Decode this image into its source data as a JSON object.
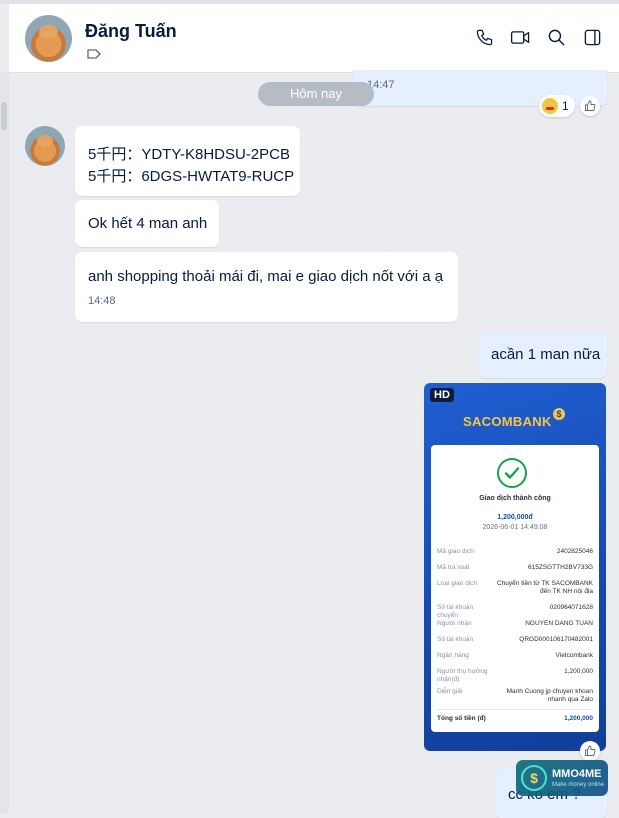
{
  "header": {
    "contact_name": "Đăng Tuấn",
    "icons": [
      "phone-icon",
      "video-call-icon",
      "search-icon",
      "sidebar-toggle-icon"
    ]
  },
  "conversation": {
    "previous_message_time": "14:47",
    "date_separator": "Hôm nay",
    "reaction": {
      "emoji": "laughing-emoji",
      "count": "1"
    },
    "messages": [
      {
        "sender": "contact",
        "lines": [
          "5千円：YDTY-K8HDSU-2PCB",
          "5千円：6DGS-HWTAT9-RUCP"
        ]
      },
      {
        "sender": "contact",
        "text": "Ok hết 4 man anh"
      },
      {
        "sender": "contact",
        "text": "anh shopping thoải mái đi, mai e giao dịch nốt với a ạ",
        "time": "14:48"
      },
      {
        "sender": "me",
        "text": "acần 1 man nữa"
      },
      {
        "sender": "me",
        "text": "cc ko em ?"
      }
    ],
    "image_message": {
      "badge": "HD",
      "bank_name": "SACOMBANK",
      "bank_logo_symbol": "$",
      "status": "Giao dịch thành công",
      "amount": "1,200,000đ",
      "datetime": "2026-06-01 14:49:08",
      "rows": [
        {
          "label": "Mã giao dịch",
          "value": "2402825046"
        },
        {
          "label": "Mã tra soát",
          "value": "615ZSGTTH2BV733G"
        },
        {
          "label": "Loại giao dịch",
          "value": "Chuyển tiền từ TK SACOMBANK đến TK NH nội địa"
        },
        {
          "label": "Số tài khoản chuyển",
          "value": "020964071628"
        },
        {
          "label": "Người nhận",
          "value": "NGUYEN DANG TUAN"
        },
        {
          "label": "Số tài khoản",
          "value": "QRGD0001061704820​01"
        },
        {
          "label": "Ngân hàng",
          "value": "Vietcombank"
        },
        {
          "label": "Người thụ hưởng nhận(đ)",
          "value": "1,200,000"
        },
        {
          "label": "Diễn giải",
          "value": "Manh Cuong jp chuyen khoan nhanh qua Zalo"
        }
      ],
      "total": {
        "label": "Tổng số tiền (đ)",
        "value": "1,200,000"
      }
    }
  },
  "watermark": {
    "title": "MMO4ME",
    "subtitle": "Make money online"
  },
  "colors": {
    "app_bg": "#ebecf0",
    "my_bubble": "#e5efff",
    "contact_bubble": "#ffffff",
    "bank_blue": "#1549b0",
    "bank_gold": "#f6c744",
    "success_green": "#17a34a"
  }
}
